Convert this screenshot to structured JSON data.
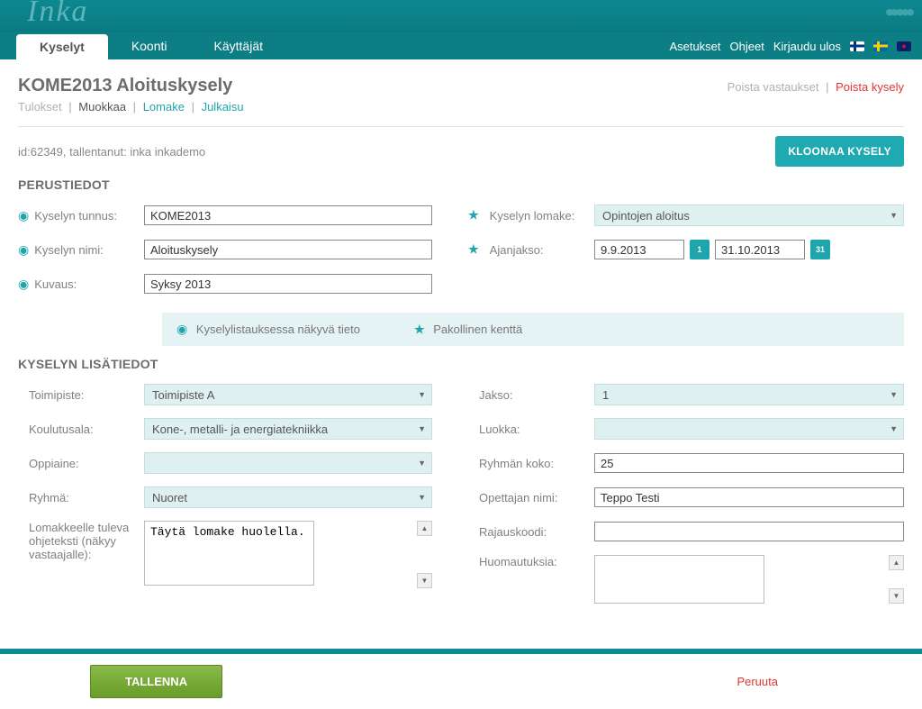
{
  "logo": "Inka",
  "nav": {
    "tabs": [
      "Kyselyt",
      "Koonti",
      "Käyttäjät"
    ],
    "right": {
      "settings": "Asetukset",
      "help": "Ohjeet",
      "logout": "Kirjaudu ulos"
    }
  },
  "page": {
    "title": "KOME2013 Aloituskysely",
    "clearAnswers": "Poista vastaukset",
    "deleteSurvey": "Poista kysely",
    "subtabs": {
      "results": "Tulokset",
      "edit": "Muokkaa",
      "form": "Lomake",
      "publish": "Julkaisu"
    },
    "meta": "id:62349, tallentanut: inka inkademo",
    "clone": "KLOONAA KYSELY"
  },
  "basics": {
    "heading": "PERUSTIEDOT",
    "labels": {
      "id": "Kyselyn tunnus:",
      "name": "Kyselyn nimi:",
      "desc": "Kuvaus:",
      "form": "Kyselyn lomake:",
      "period": "Ajanjakso:"
    },
    "values": {
      "id": "KOME2013",
      "name": "Aloituskysely",
      "desc": "Syksy 2013",
      "form": "Opintojen aloitus",
      "start": "9.9.2013",
      "end": "31.10.2013"
    },
    "cal1": "1",
    "cal2": "31"
  },
  "legend": {
    "visible": "Kyselylistauksessa näkyvä tieto",
    "required": "Pakollinen kenttä"
  },
  "extra": {
    "heading": "KYSELYN LISÄTIEDOT",
    "labels": {
      "office": "Toimipiste:",
      "field": "Koulutusala:",
      "subject": "Oppiaine:",
      "group": "Ryhmä:",
      "help": "Lomakkeelle tuleva ohjeteksti (näkyy vastaajalle):",
      "period2": "Jakso:",
      "class": "Luokka:",
      "size": "Ryhmän koko:",
      "teacher": "Opettajan nimi:",
      "filter": "Rajauskoodi:",
      "notes": "Huomautuksia:"
    },
    "values": {
      "office": "Toimipiste A",
      "field": "Kone-, metalli- ja energiatekniikka",
      "subject": "",
      "group": "Nuoret",
      "help": "Täytä lomake huolella.",
      "period2": "1",
      "class": "",
      "size": "25",
      "teacher": "Teppo Testi",
      "filter": "",
      "notes": ""
    }
  },
  "footer": {
    "save": "TALLENNA",
    "cancel": "Peruuta"
  }
}
